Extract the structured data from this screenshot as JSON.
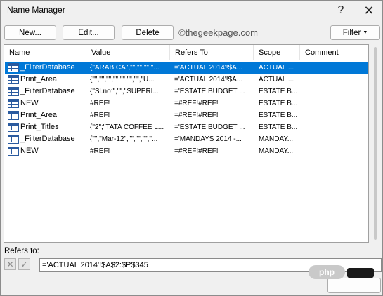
{
  "window": {
    "title": "Name Manager"
  },
  "toolbar": {
    "new_label": "New...",
    "edit_label": "Edit...",
    "delete_label": "Delete",
    "filter_label": "Filter",
    "watermark": "©thegeekpage.com"
  },
  "columns": [
    "Name",
    "Value",
    "Refers To",
    "Scope",
    "Comment"
  ],
  "rows": [
    {
      "name": "_FilterDatabase",
      "value": "{\"ARABICA\",\"\",\"\",\"\",\"...",
      "refers": "='ACTUAL 2014'!$A...",
      "scope": "ACTUAL ...",
      "comment": "",
      "selected": true
    },
    {
      "name": "Print_Area",
      "value": "{\"\",\"\",\"\",\"\",\"\",\"\",\"\",\"U...",
      "refers": "='ACTUAL 2014'!$A...",
      "scope": "ACTUAL ...",
      "comment": "",
      "selected": false
    },
    {
      "name": "_FilterDatabase",
      "value": "{\"Sl.no:\",\"\",\"SUPERI...",
      "refers": "='ESTATE BUDGET ...",
      "scope": "ESTATE B...",
      "comment": "",
      "selected": false
    },
    {
      "name": "NEW",
      "value": "#REF!",
      "refers": "=#REF!#REF!",
      "scope": "ESTATE B...",
      "comment": "",
      "selected": false
    },
    {
      "name": "Print_Area",
      "value": "#REF!",
      "refers": "=#REF!#REF!",
      "scope": "ESTATE B...",
      "comment": "",
      "selected": false
    },
    {
      "name": "Print_Titles",
      "value": "{\"2\";\"TATA COFFEE L...",
      "refers": "='ESTATE BUDGET ...",
      "scope": "ESTATE B...",
      "comment": "",
      "selected": false
    },
    {
      "name": "_FilterDatabase",
      "value": "{\"\",\"Mar-12\",\"\",\"\",\"\",\"...",
      "refers": "='MANDAYS 2014 -...",
      "scope": "MANDAY...",
      "comment": "",
      "selected": false
    },
    {
      "name": "NEW",
      "value": "#REF!",
      "refers": "=#REF!#REF!",
      "scope": "MANDAY...",
      "comment": "",
      "selected": false
    }
  ],
  "refers_to": {
    "label": "Refers to:",
    "value": "='ACTUAL 2014'!$A$2:$P$345"
  },
  "overlay": {
    "badge": "php"
  }
}
